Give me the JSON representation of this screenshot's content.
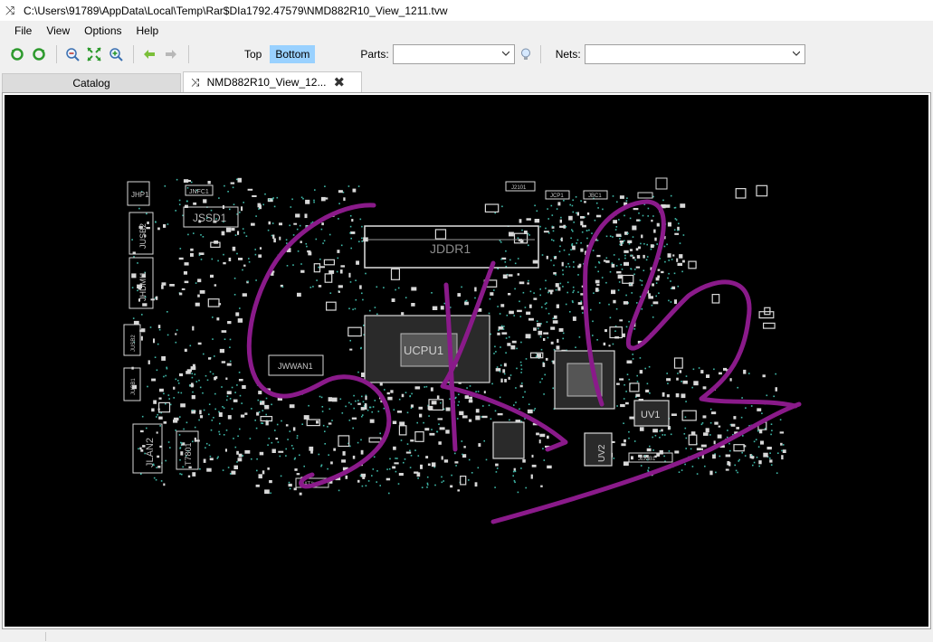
{
  "window": {
    "title": "C:\\Users\\91789\\AppData\\Local\\Temp\\Rar$DIa1792.47579\\NMD882R10_View_1211.tvw",
    "icon": "shuffle-icon"
  },
  "menu": {
    "items": [
      "File",
      "View",
      "Options",
      "Help"
    ]
  },
  "toolbar": {
    "top_label": "Top",
    "bottom_label": "Bottom",
    "active_side": "Bottom",
    "parts_label": "Parts:",
    "parts_value": "",
    "nets_label": "Nets:",
    "nets_value": ""
  },
  "tabs": [
    {
      "label": "Catalog",
      "active": false
    },
    {
      "label": "NMD882R10_View_12...",
      "active": true
    }
  ],
  "board": {
    "labels": [
      "JHP1",
      "JNFC1",
      "JSSD1",
      "JUSB2",
      "JHDMI1",
      "JUSB2",
      "JUSB1",
      "JLAN2",
      "T7801",
      "JWWAN1",
      "JDDR1",
      "UCPU1",
      "UV1",
      "UV2",
      "JCP1",
      "JBC1",
      "J2101",
      "JEMB1",
      "JAT1"
    ],
    "colors": {
      "background": "#000000",
      "component": "#d8d8d8",
      "pad": "#3fb8a8",
      "annotation": "#8a1a8a"
    }
  }
}
